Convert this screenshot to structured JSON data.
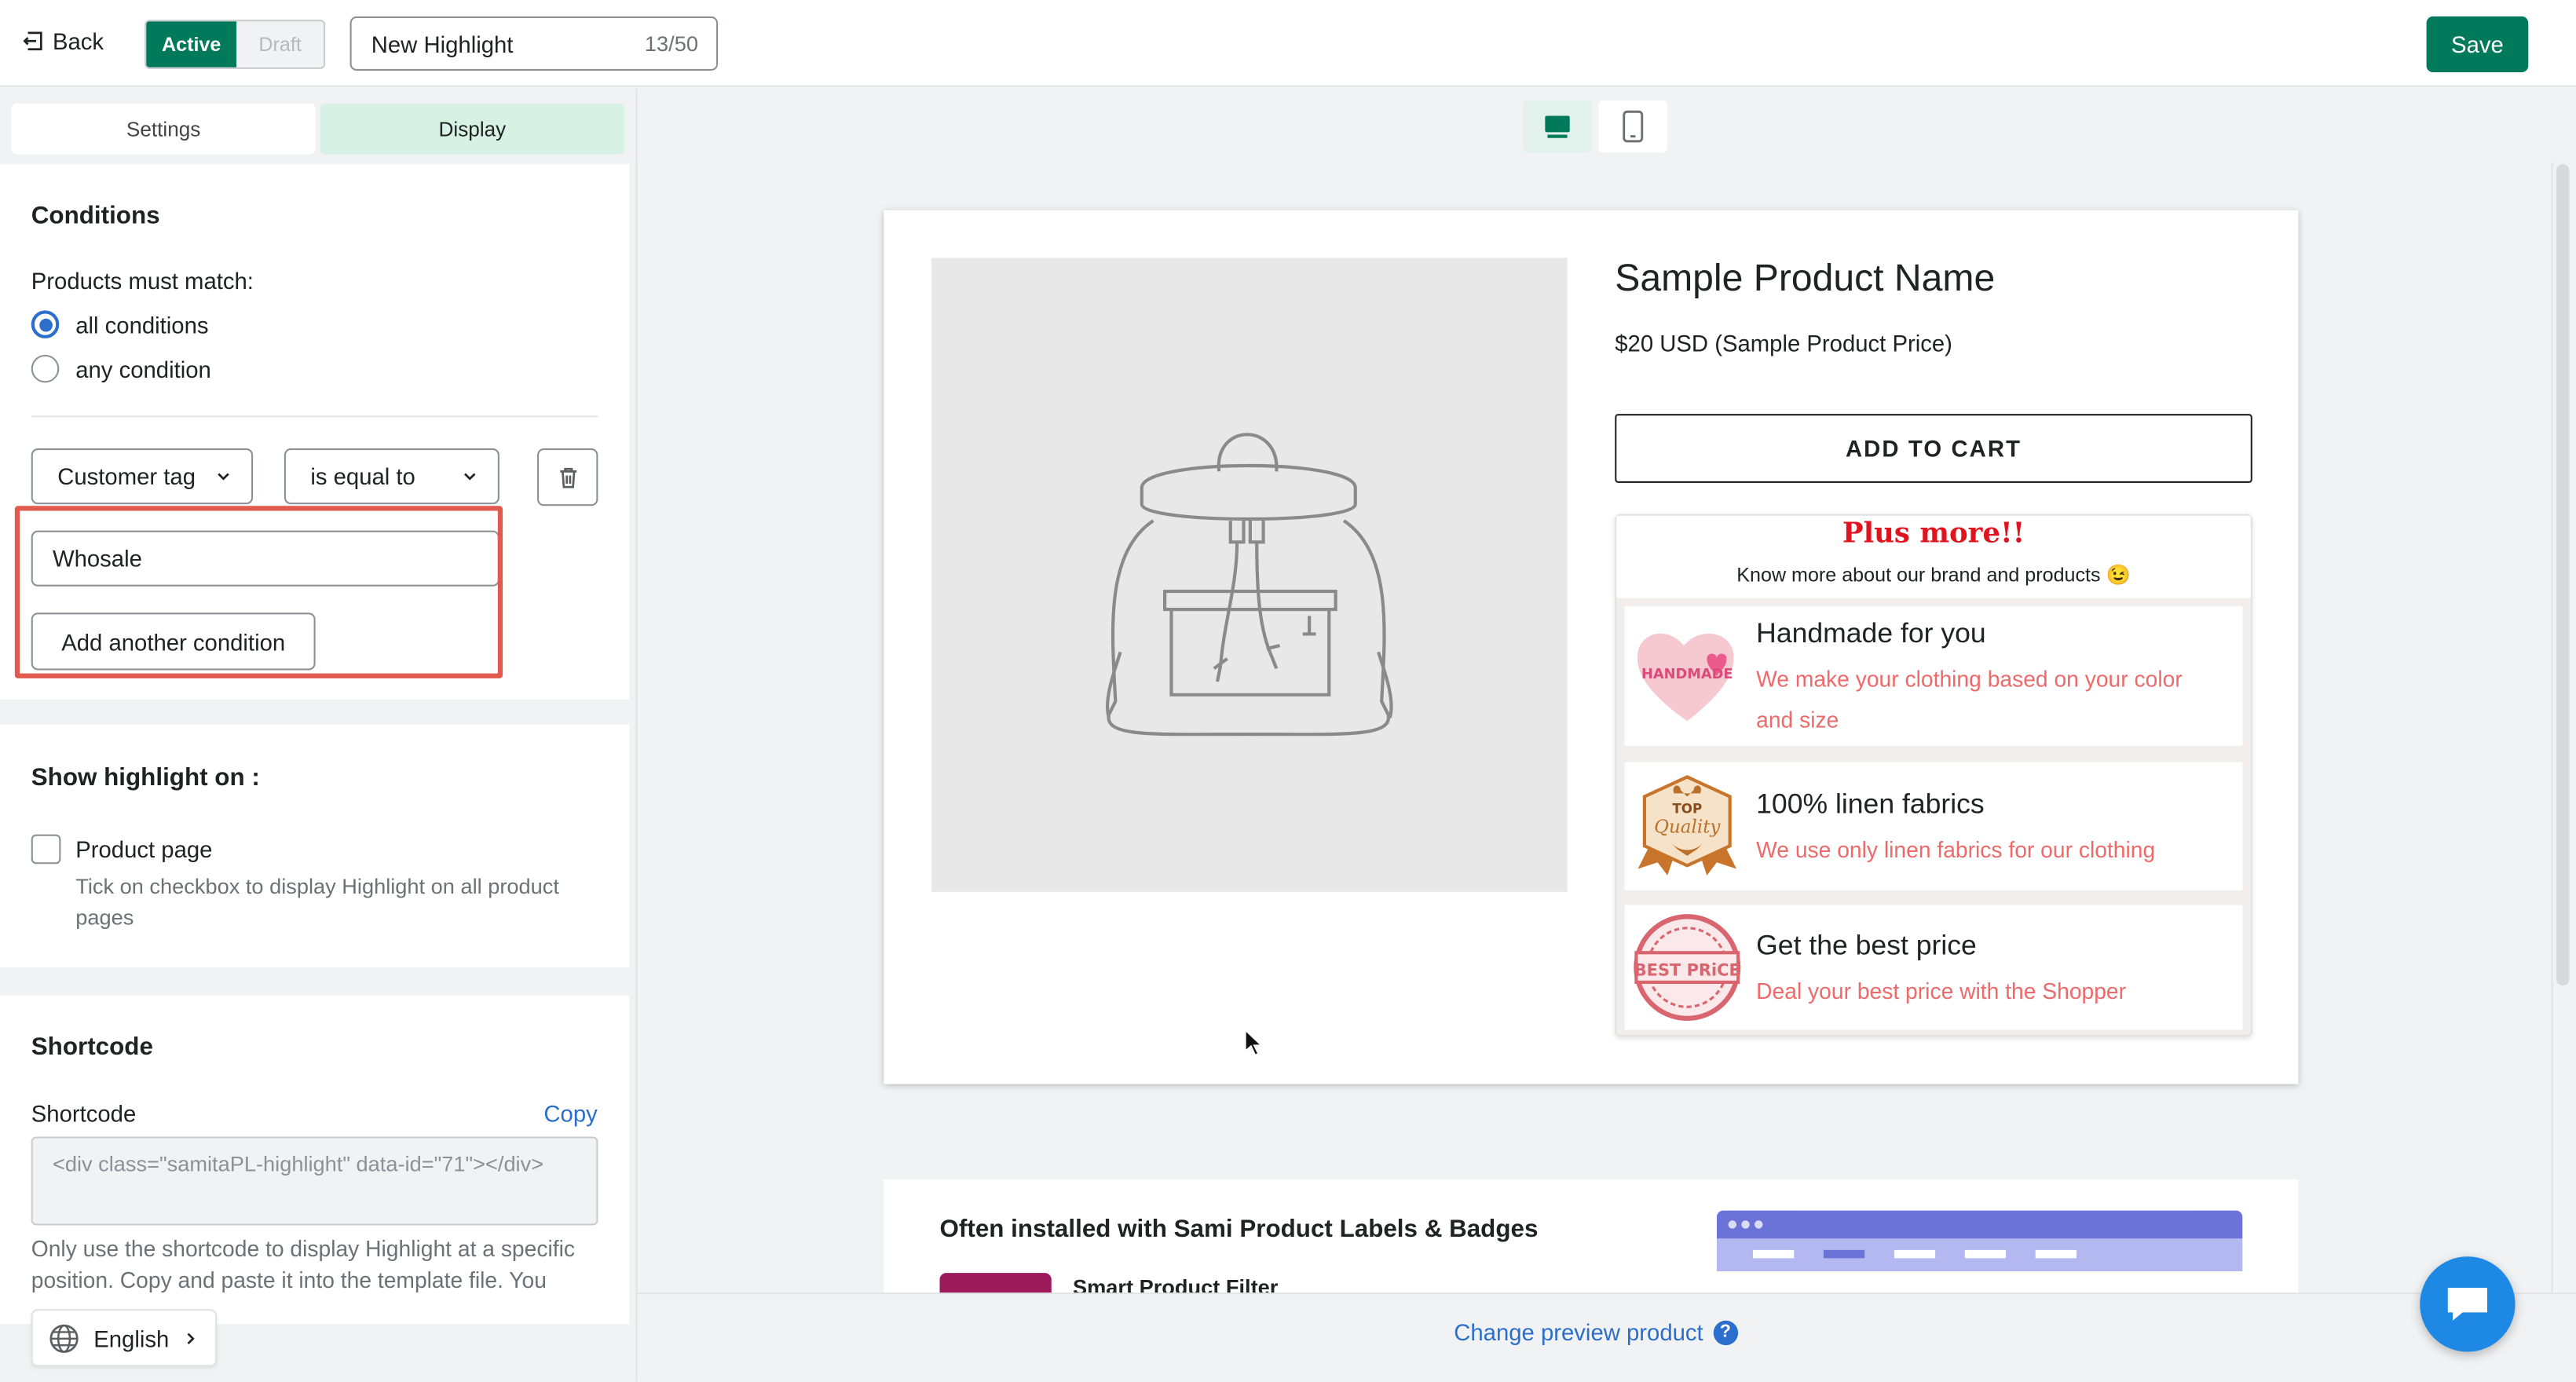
{
  "topbar": {
    "back_label": "Back",
    "status_active": "Active",
    "status_draft": "Draft",
    "title_value": "New Highlight",
    "title_count": "13/50",
    "save_label": "Save"
  },
  "tabs": {
    "settings": "Settings",
    "display": "Display"
  },
  "conditions": {
    "heading": "Conditions",
    "match_label": "Products must match:",
    "option_all": "all conditions",
    "option_any": "any condition",
    "selected": "all conditions",
    "field_select": "Customer tag",
    "operator_select": "is equal to",
    "value": "Whosale",
    "add_button": "Add another condition"
  },
  "show_on": {
    "heading": "Show highlight on :",
    "product_page_label": "Product page",
    "product_page_help": "Tick on checkbox to display Highlight on all product pages",
    "product_page_checked": false
  },
  "shortcode": {
    "heading": "Shortcode",
    "label": "Shortcode",
    "copy_label": "Copy",
    "code": "<div class=\"samitaPL-highlight\" data-id=\"71\"></div>",
    "help": "Only use the shortcode to display Highlight at a specific position. Copy and paste it into the template file. You"
  },
  "language": {
    "label": "English"
  },
  "preview": {
    "device_selected": "desktop",
    "product_name": "Sample Product Name",
    "product_price": "$20 USD (Sample Product Price)",
    "cart_button": "ADD TO CART",
    "highlight": {
      "title": "Plus more!!",
      "subtitle": "Know more about our brand and products 😉",
      "items": [
        {
          "title": "Handmade for you",
          "desc": "We make your clothing based on your color and size",
          "icon": "handmade-heart-icon",
          "icon_text": "HANDMADE"
        },
        {
          "title": "100% linen fabrics",
          "desc": "We use only linen fabrics for our clothing",
          "icon": "top-quality-badge-icon",
          "icon_text_1": "TOP",
          "icon_text_2": "Quality"
        },
        {
          "title": "Get the best price",
          "desc": "Deal your best price with the Shopper",
          "icon": "best-price-stamp-icon",
          "icon_text": "BEST PRiCE"
        }
      ]
    },
    "reco_title": "Often installed with Sami Product Labels & Badges",
    "reco_item": "Smart Product Filter",
    "change_preview": "Change preview product"
  },
  "colors": {
    "primary": "#007a5a",
    "link": "#2c6ecb",
    "highlight_red": "#e0141e",
    "desc_pink": "#ee6a6a",
    "chat_blue": "#1e88e5"
  }
}
